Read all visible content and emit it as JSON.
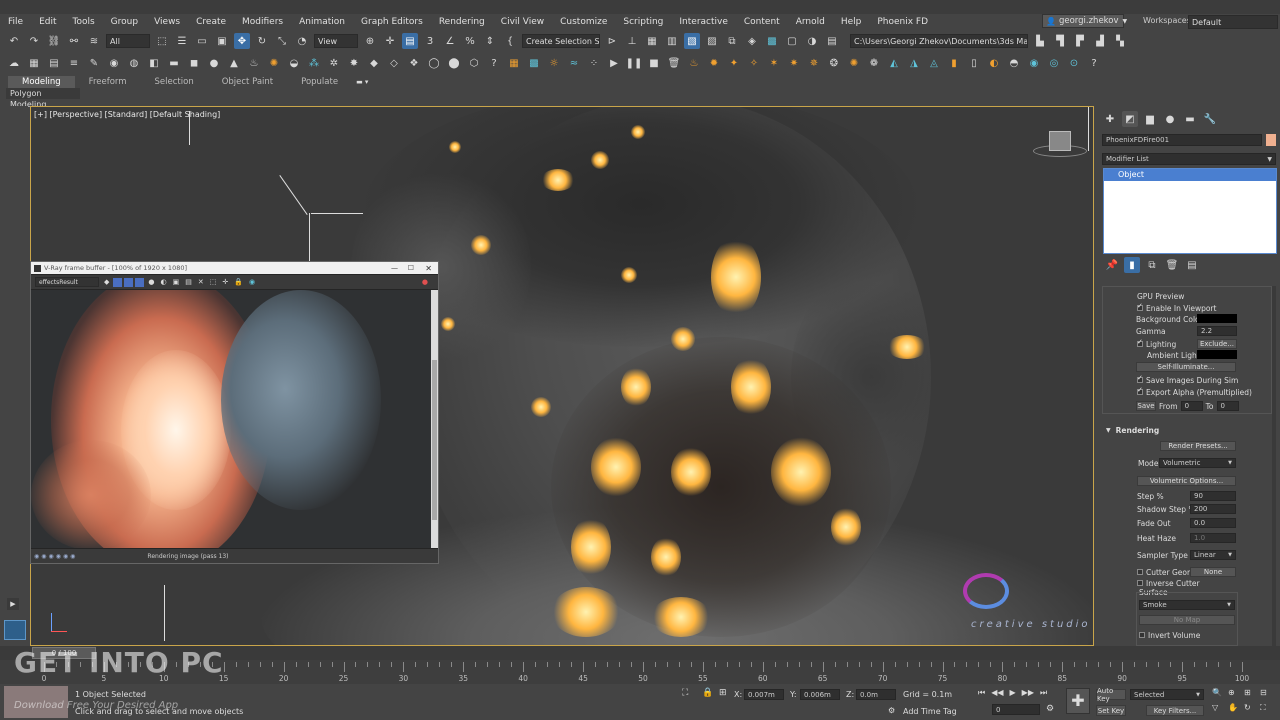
{
  "menu": {
    "items": [
      "File",
      "Edit",
      "Tools",
      "Group",
      "Views",
      "Create",
      "Modifiers",
      "Animation",
      "Graph Editors",
      "Rendering",
      "Civil View",
      "Customize",
      "Scripting",
      "Interactive",
      "Content",
      "Arnold",
      "Help",
      "Phoenix FD"
    ],
    "user": "georgi.zhekov",
    "workspaces_label": "Workspaces:",
    "workspace_value": "Default"
  },
  "toolbar": {
    "filter_value": "All",
    "view_value": "View",
    "selection_set_placeholder": "Create Selection Se",
    "path_value": "C:\\Users\\Georgi Zhekov\\Documents\\3ds Max 2020"
  },
  "ribbon": {
    "tabs": [
      "Modeling",
      "Freeform",
      "Selection",
      "Object Paint",
      "Populate"
    ],
    "active_tab": "Modeling",
    "sub_label": "Polygon Modeling"
  },
  "viewport": {
    "label": "[+] [Perspective] [Standard] [Default Shading]"
  },
  "vfb": {
    "title": "V-Ray frame buffer - [100% of 1920 x 1080]",
    "channel": "effectsResult",
    "status": "Rendering image (pass 13)"
  },
  "watermark": {
    "studio_text": "creative studio"
  },
  "right_panel": {
    "object_name": "PhoenixFDFire001",
    "modifier_list": "Modifier List",
    "stack_item": "Object",
    "gpu_preview": {
      "header": "GPU Preview",
      "enable_in_viewport": "Enable In Viewport",
      "background_color": "Background Color",
      "gamma_label": "Gamma",
      "gamma_value": "2.2",
      "lighting": "Lighting",
      "exclude": "Exclude...",
      "ambient_light": "Ambient Light",
      "self_illuminate": "Self-Illuminate...",
      "save_images": "Save Images During Sim",
      "export_alpha": "Export Alpha (Premultiplied)",
      "save": "Save",
      "from": "From",
      "from_value": "0",
      "to": "To",
      "to_value": "0"
    },
    "rendering": {
      "header": "Rendering",
      "render_presets": "Render Presets...",
      "mode_label": "Mode",
      "mode_value": "Volumetric",
      "volumetric_options": "Volumetric Options...",
      "step_label": "Step %",
      "step_value": "90",
      "shadow_step_label": "Shadow Step %",
      "shadow_step_value": "200",
      "fade_out_label": "Fade Out",
      "fade_out_value": "0.0",
      "heat_haze_label": "Heat Haze",
      "heat_haze_value": "1.0",
      "sampler_type_label": "Sampler Type",
      "sampler_type_value": "Linear",
      "cutter_geom": "Cutter Geom",
      "cutter_geom_value": "None",
      "inverse_cutter": "Inverse Cutter",
      "surface": "Surface",
      "surface_value": "Smoke",
      "no_map": "No Map",
      "invert_volume": "Invert Volume"
    }
  },
  "timeline": {
    "frame_counter": "0 / 100",
    "ticks": [
      "0",
      "5",
      "10",
      "15",
      "20",
      "25",
      "30",
      "35",
      "40",
      "45",
      "50",
      "55",
      "60",
      "65",
      "70",
      "75",
      "80",
      "85",
      "90",
      "95",
      "100"
    ]
  },
  "status": {
    "selected": "1 Object Selected",
    "prompt": "Click and drag to select and move objects",
    "x_label": "X:",
    "x_value": "0.007m",
    "y_label": "Y:",
    "y_value": "0.006m",
    "z_label": "Z:",
    "z_value": "0.0m",
    "grid": "Grid = 0.1m",
    "add_time_tag": "Add Time Tag",
    "frame_value": "0",
    "auto_key": "Auto Key",
    "selected_dropdown": "Selected",
    "set_key": "Set Key",
    "key_filters": "Key Filters..."
  },
  "overlay": {
    "getintopc": "GET INTO PC",
    "download": "Download Free Your Desired App"
  },
  "colors": {
    "accent_blue": "#3a6ea5",
    "selection_border": "#c9a54a",
    "object_color_swatch": "#f0b090"
  }
}
